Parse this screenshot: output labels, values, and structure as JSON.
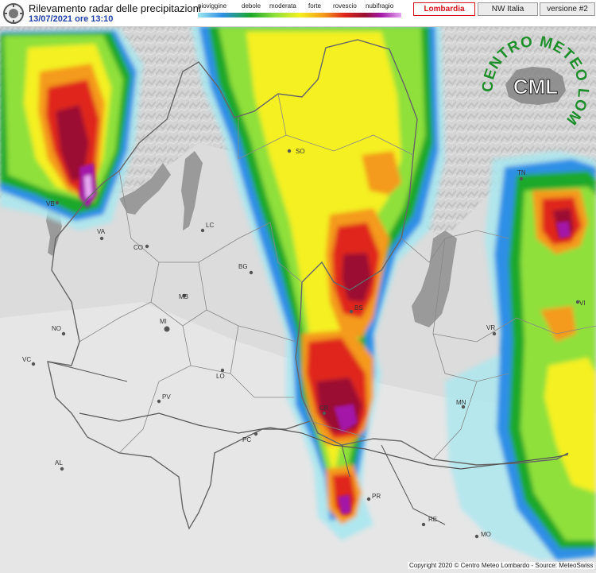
{
  "header": {
    "title": "Rilevamento radar delle precipitazioni",
    "datetime": "13/07/2021 ore 13:10"
  },
  "legend": {
    "labels": [
      "pioviggine",
      "debole",
      "moderata",
      "forte",
      "rovescio",
      "nubifragio"
    ]
  },
  "tabs": {
    "lombardia": "Lombardia",
    "nw_italia": "NW Italia",
    "version": "versione #2"
  },
  "logo": {
    "arc_text": "CENTRO METEO LOMBARDO",
    "initials": "CML"
  },
  "cities": [
    {
      "code": "SO"
    },
    {
      "code": "VB"
    },
    {
      "code": "VA"
    },
    {
      "code": "CO"
    },
    {
      "code": "LC"
    },
    {
      "code": "BG"
    },
    {
      "code": "MB"
    },
    {
      "code": "MI"
    },
    {
      "code": "NO"
    },
    {
      "code": "VC"
    },
    {
      "code": "LO"
    },
    {
      "code": "PV"
    },
    {
      "code": "PC"
    },
    {
      "code": "AL"
    },
    {
      "code": "BS"
    },
    {
      "code": "CR"
    },
    {
      "code": "MN"
    },
    {
      "code": "VR"
    },
    {
      "code": "TN"
    },
    {
      "code": "VI"
    },
    {
      "code": "PR"
    },
    {
      "code": "RE"
    },
    {
      "code": "MO"
    }
  ],
  "footer": {
    "copyright": "Copyright 2020 © Centro Meteo Lombardo - Source: MeteoSwiss"
  },
  "colors": {
    "tab_active": "#d3121b",
    "datetime": "#1f3fa8"
  }
}
